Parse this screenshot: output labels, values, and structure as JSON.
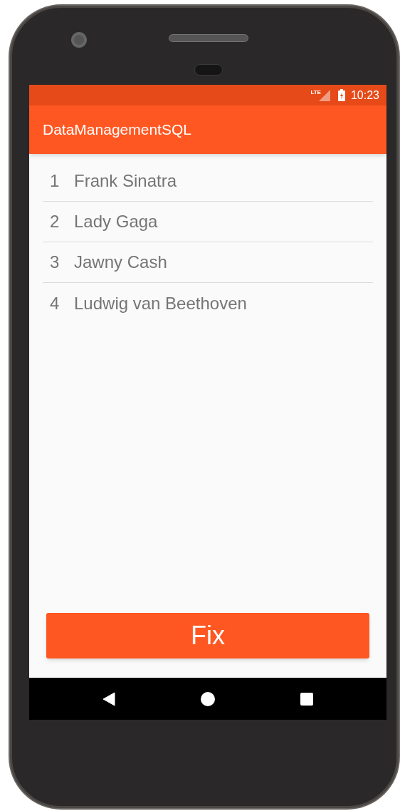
{
  "status_bar": {
    "network": "LTE",
    "time": "10:23"
  },
  "app_bar": {
    "title": "DataManagementSQL"
  },
  "list": [
    {
      "number": "1",
      "name": "Frank Sinatra"
    },
    {
      "number": "2",
      "name": "Lady Gaga"
    },
    {
      "number": "3",
      "name": "Jawny Cash"
    },
    {
      "number": "4",
      "name": "Ludwig van Beethoven"
    }
  ],
  "button": {
    "label": "Fix"
  }
}
